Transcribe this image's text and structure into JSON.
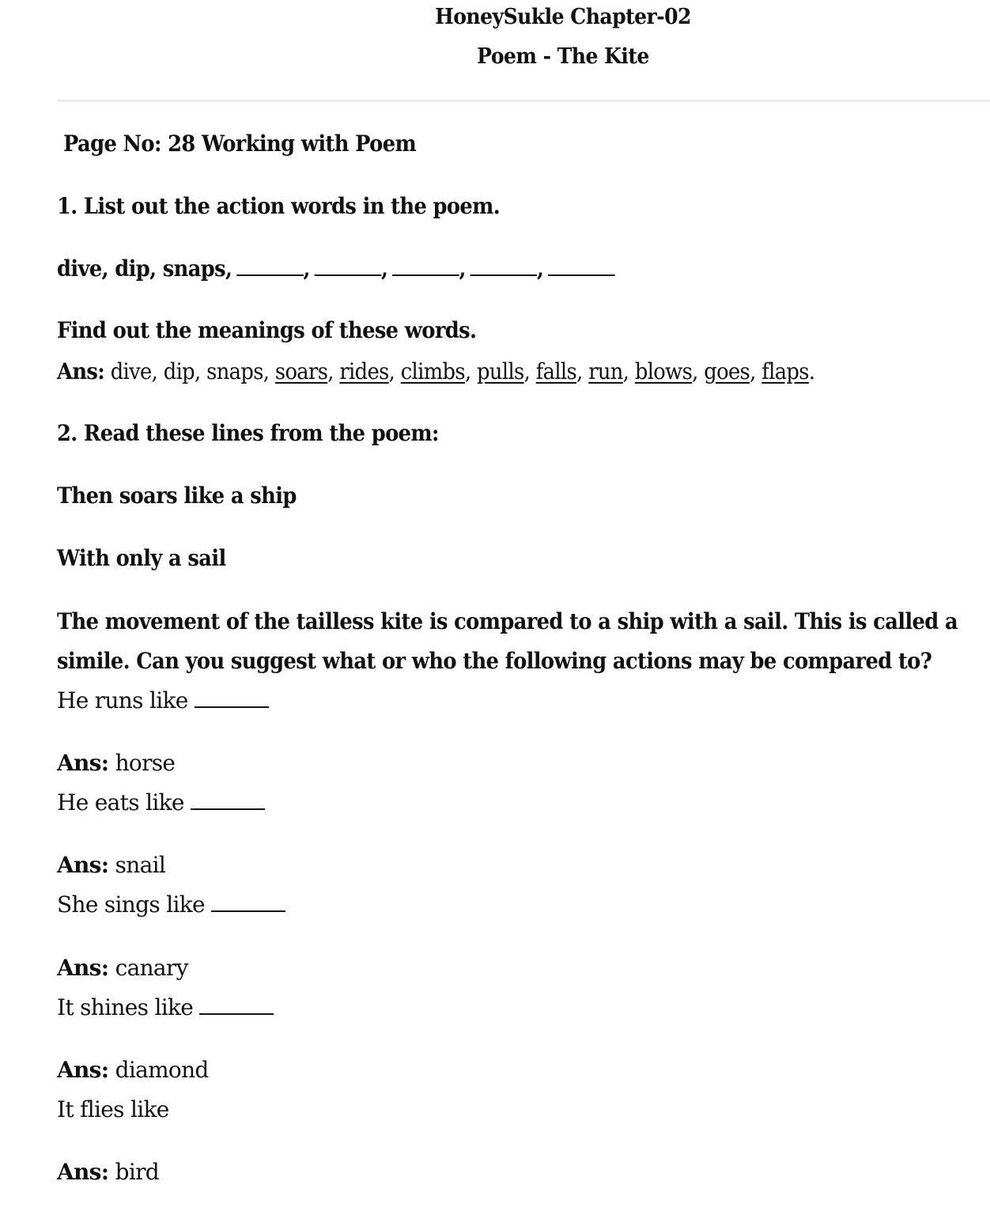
{
  "header": {
    "title": "HoneySukle Chapter-02",
    "subtitle": "Poem - The Kite"
  },
  "section": {
    "heading": "Page No: 28 Working with Poem"
  },
  "q1": {
    "question": "1.  List out the action words in the poem.",
    "prompt_words": "dive, dip, snaps,",
    "blank_count": 5,
    "sub_question": "Find out the meanings of these words.",
    "answer_label": "Ans:",
    "answer_plain": " dive, dip, snaps, ",
    "answer_underlined": [
      "soars",
      "rides",
      "climbs",
      "pulls",
      "falls",
      "run",
      "blows",
      "goes",
      "flaps"
    ]
  },
  "q2": {
    "question": "2.  Read these lines from the poem:",
    "poem_line_1": "Then soars like a ship",
    "poem_line_2": "With only a sail",
    "explanation_line_1": "The movement of the tailless kite is compared to a ship with a sail. This is called a",
    "explanation_line_2": "simile. Can you suggest what or who the following actions may be compared to?",
    "items": [
      {
        "prompt": "He runs like",
        "has_blank": true,
        "answer_label": "Ans:",
        "answer": " horse"
      },
      {
        "prompt": "He eats like",
        "has_blank": true,
        "answer_label": "Ans:",
        "answer": " snail"
      },
      {
        "prompt": "She sings like",
        "has_blank": true,
        "answer_label": "Ans:",
        "answer": " canary"
      },
      {
        "prompt": "It shines like",
        "has_blank": true,
        "answer_label": "Ans:",
        "answer": " diamond"
      },
      {
        "prompt": "It flies like",
        "has_blank": false,
        "answer_label": "Ans:",
        "answer": " bird"
      }
    ]
  }
}
